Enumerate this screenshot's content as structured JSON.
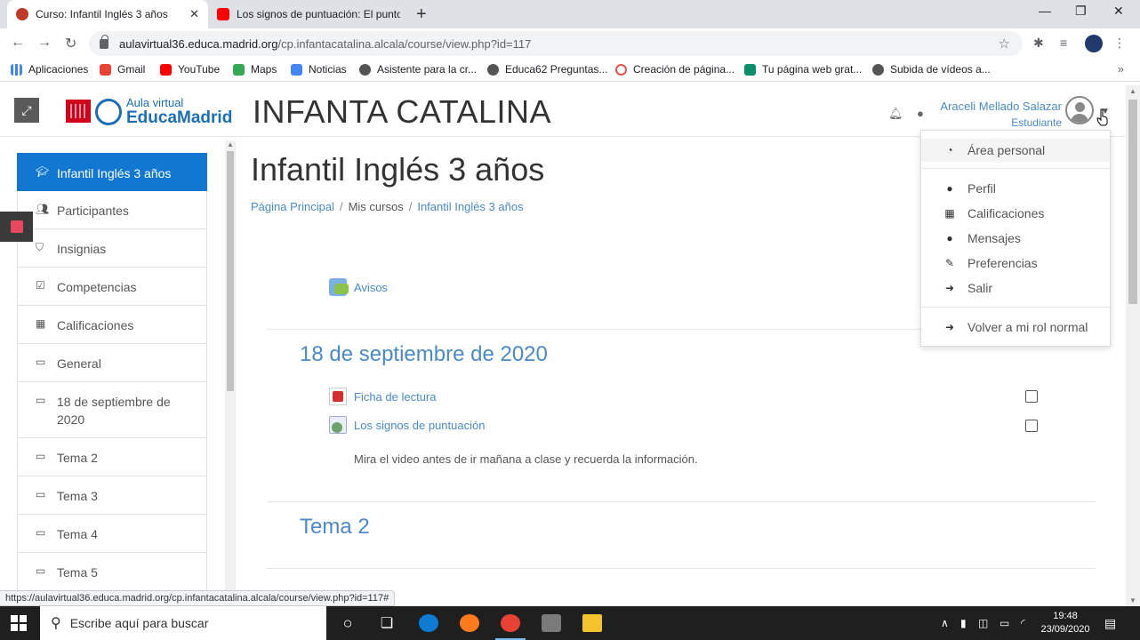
{
  "browser": {
    "tabs": [
      {
        "title": "Curso: Infantil Inglés 3 años",
        "favicon": "educamadrid-favicon"
      },
      {
        "title": "Los signos de puntuación: El punto",
        "favicon": "youtube-favicon"
      }
    ],
    "url_host": "aulavirtual36.educa.madrid.org",
    "url_path": "/cp.infantacatalina.alcala/course/view.php?id=117",
    "bookmarks": [
      "Aplicaciones",
      "Gmail",
      "YouTube",
      "Maps",
      "Noticias",
      "Asistente para la cr...",
      "Educa62 Preguntas...",
      "Creación de página...",
      "Tu página web grat...",
      "Subida de vídeos a..."
    ]
  },
  "header": {
    "logo_small": "Aula virtual",
    "logo_big": "EducaMadrid",
    "site_title": "INFANTA CATALINA",
    "user_name": "Araceli Mellado Salazar",
    "user_role": "Estudiante"
  },
  "sidebar": {
    "items": [
      {
        "label": "Infantil Inglés 3 años",
        "icon": "graduation-cap-icon"
      },
      {
        "label": "Participantes",
        "icon": "users-icon"
      },
      {
        "label": "Insignias",
        "icon": "shield-icon"
      },
      {
        "label": "Competencias",
        "icon": "checkbox-icon"
      },
      {
        "label": "Calificaciones",
        "icon": "table-icon"
      },
      {
        "label": "General",
        "icon": "folder-icon"
      },
      {
        "label": "18 de septiembre de 2020",
        "icon": "folder-icon"
      },
      {
        "label": "Tema 2",
        "icon": "folder-icon"
      },
      {
        "label": "Tema 3",
        "icon": "folder-icon"
      },
      {
        "label": "Tema 4",
        "icon": "folder-icon"
      },
      {
        "label": "Tema 5",
        "icon": "folder-icon"
      }
    ]
  },
  "main": {
    "course_title": "Infantil Inglés 3 años",
    "breadcrumb": [
      "Página Principal",
      "Mis cursos",
      "Infantil Inglés 3 años"
    ],
    "avisos": "Avisos",
    "sections": [
      {
        "title": "18 de septiembre de 2020",
        "activities": [
          "Ficha de lectura",
          "Los signos de puntuación"
        ],
        "description": "Mira el video antes de ir mañana a clase y recuerda la información."
      },
      {
        "title": "Tema 2"
      }
    ]
  },
  "user_menu": {
    "items": [
      "Área personal",
      "Perfil",
      "Calificaciones",
      "Mensajes",
      "Preferencias",
      "Salir",
      "Volver a mi rol normal"
    ]
  },
  "statusbar": "https://aulavirtual36.educa.madrid.org/cp.infantacatalina.alcala/course/view.php?id=117#",
  "taskbar": {
    "search_placeholder": "Escribe aquí para buscar",
    "time": "19:48",
    "date": "23/09/2020"
  }
}
